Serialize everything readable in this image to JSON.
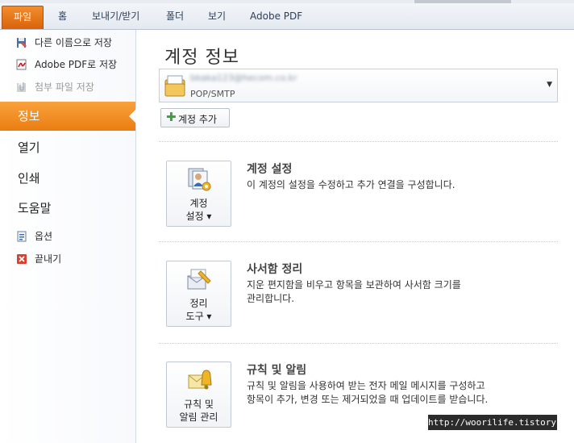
{
  "ribbon": {
    "tabs": [
      "파일",
      "홈",
      "보내기/받기",
      "폴더",
      "보기",
      "Adobe PDF"
    ]
  },
  "backstage": {
    "commands": [
      {
        "label": "다른 이름으로 저장",
        "icon": "save-as-icon",
        "enabled": true
      },
      {
        "label": "Adobe PDF로 저장",
        "icon": "adobe-pdf-icon",
        "enabled": true
      },
      {
        "label": "첨부 파일 저장",
        "icon": "save-attachments-icon",
        "enabled": false
      }
    ],
    "tabs": [
      {
        "label": "정보",
        "active": true
      },
      {
        "label": "열기",
        "active": false
      },
      {
        "label": "인쇄",
        "active": false
      },
      {
        "label": "도움말",
        "active": false
      }
    ],
    "bottom_commands": [
      {
        "label": "옵션",
        "icon": "options-icon"
      },
      {
        "label": "끝내기",
        "icon": "exit-icon"
      }
    ]
  },
  "main": {
    "title": "계정 정보",
    "account": {
      "email": "bkaka123@hecom.co.kr",
      "type": "POP/SMTP"
    },
    "add_account_label": "계정 추가",
    "sections": [
      {
        "button_line1": "계정",
        "button_line2": "설정 ▾",
        "title": "계정 설정",
        "description": "이 계정의 설정을 수정하고 추가 연결을 구성합니다."
      },
      {
        "button_line1": "정리",
        "button_line2": "도구 ▾",
        "title": "사서함 정리",
        "description": "지운 편지함을 비우고 항목을 보관하여 사서함 크기를\n관리합니다."
      },
      {
        "button_line1": "규칙 및",
        "button_line2": "알림 관리",
        "title": "규칙 및 알림",
        "description": "규칙 및 알림을 사용하여 받는 전자 메일 메시지를 구성하고\n항목이 추가, 변경 또는 제거되었을 때 업데이트를 받습니다."
      }
    ]
  },
  "watermark": "http://woorilife.tistory.com",
  "colors": {
    "accent": "#f08a24",
    "ribbon": "#e4e9f1"
  }
}
